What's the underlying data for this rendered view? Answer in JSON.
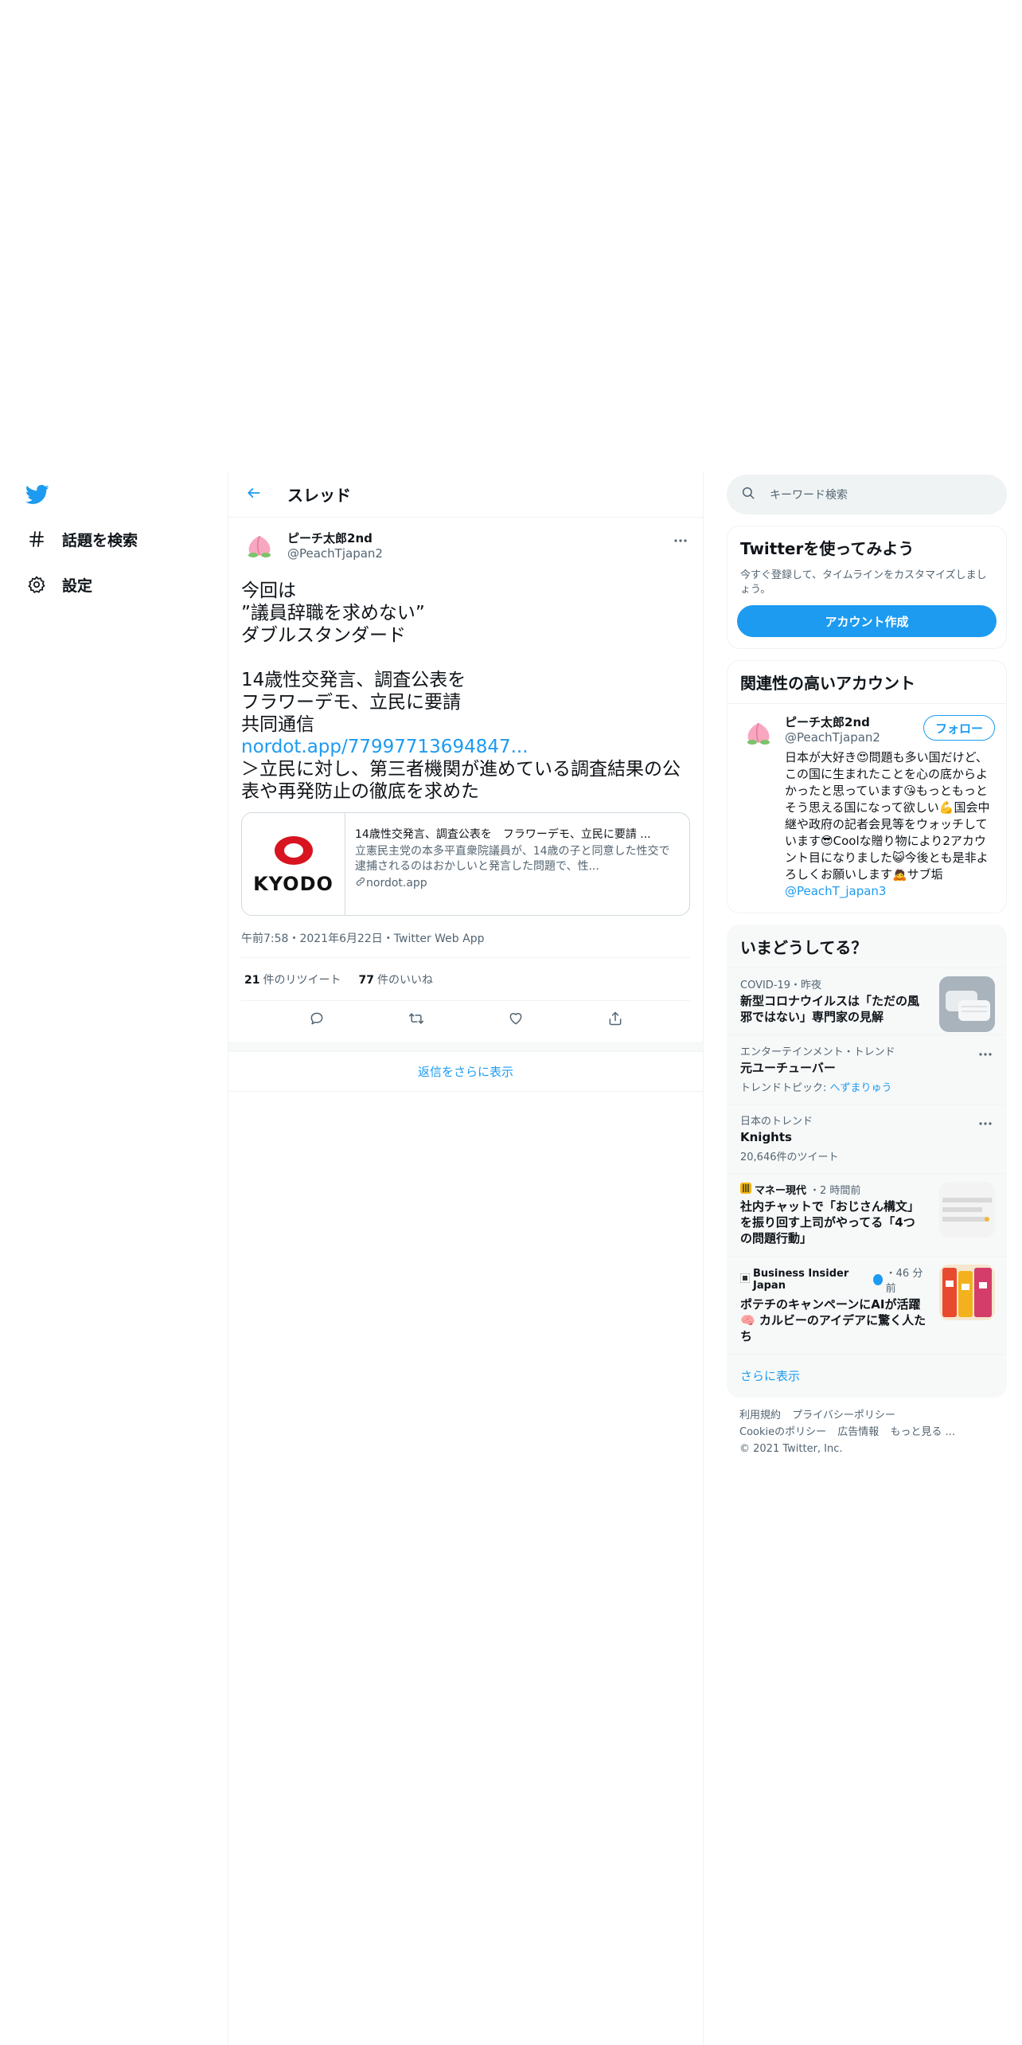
{
  "nav": {
    "logo_icon": "twitter-bird-icon",
    "items": [
      {
        "icon": "hashtag-icon",
        "label": "話題を検索"
      },
      {
        "icon": "gear-icon",
        "label": "設定"
      }
    ]
  },
  "thread": {
    "header_title": "スレッド",
    "back_icon": "arrow-left-icon"
  },
  "tweet": {
    "author_name": "ピーチ太郎2nd",
    "author_handle": "@PeachTjapan2",
    "body_lines_1": "今回は\n”議員辞職を求めない”\nダブルスタンダード\n\n14歳性交発言、調査公表を\nフラワーデモ、立民に要請\n共同通信",
    "body_link": "nordot.app/77997713694847...",
    "body_lines_2": "＞立民に対し、第三者機関が進めている調査結果の公表や再発防止の徹底を求めた",
    "card": {
      "logo_text": "KYODO",
      "title": "14歳性交発言、調査公表を　フラワーデモ、立民に要請 ...",
      "description": "立憲民主党の本多平直衆院議員が、14歳の子と同意した性交で逮捕されるのはおかしいと発言した問題で、性...",
      "domain": "nordot.app"
    },
    "timestamp": "午前7:58・2021年6月22日・Twitter Web App",
    "retweets_count": "21",
    "retweets_label": "件のリツイート",
    "likes_count": "77",
    "likes_label": "件のいいね",
    "actions": [
      "reply-icon",
      "retweet-icon",
      "like-icon",
      "share-icon"
    ]
  },
  "show_more_replies": "返信をさらに表示",
  "search": {
    "placeholder": "キーワード検索"
  },
  "signup": {
    "title": "Twitterを使ってみよう",
    "description": "今すぐ登録して、タイムラインをカスタマイズしましょう。",
    "button": "アカウント作成"
  },
  "related": {
    "title": "関連性の高いアカウント",
    "account": {
      "name": "ピーチ太郎2nd",
      "handle": "@PeachTjapan2",
      "follow_label": "フォロー",
      "bio": "日本が大好き😍問題も多い国だけど、この国に生まれたことを心の底からよかったと思っています😘もっともっとそう思える国になって欲しい💪国会中継や政府の記者会見等をウォッチしています😎Coolな贈り物により2アカウント目になりました😺今後とも是非よろしくお願いします🙇サブ垢",
      "bio_mention": "@PeachT_japan3"
    }
  },
  "trends": {
    "title": "いまどうしてる？",
    "items": [
      {
        "context": "COVID-19・昨夜",
        "title": "新型コロナウイルスは「ただの風邪ではない」専門家の見解",
        "thumb": "mask-photo"
      },
      {
        "context": "エンターテインメント・トレンド",
        "title": "元ユーチューバー",
        "sub_prefix": "トレンドトピック: ",
        "sub_topic": "へずまりゅう"
      },
      {
        "context": "日本のトレンド",
        "title": "Knights",
        "sub": "20,646件のツイート"
      },
      {
        "source": "マネー現代",
        "time": "・2 時間前",
        "title": "社内チャットで「おじさん構文」を振り回す上司がやってる「4つの問題行動」",
        "thumb": "chat-screenshot"
      },
      {
        "source": "Business Insider Japan",
        "time": "・46 分前",
        "title": "ポテチのキャンペーンにAIが活躍🧠 カルビーのアイデアに驚く人たち",
        "thumb": "chips-photo"
      }
    ],
    "show_more": "さらに表示"
  },
  "footer": {
    "links_1": [
      "利用規約",
      "プライバシーポリシー"
    ],
    "links_2": [
      "Cookieのポリシー",
      "広告情報",
      "もっと見る ..."
    ],
    "copyright": "© 2021 Twitter, Inc."
  },
  "colors": {
    "accent": "#1d9bf0",
    "text": "#0f1419",
    "muted": "#536471"
  }
}
